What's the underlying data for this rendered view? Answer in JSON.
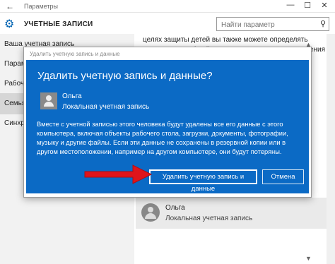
{
  "window": {
    "title": "Параметры",
    "back_glyph": "←",
    "minimize_glyph": "—",
    "maximize_glyph": "☐",
    "close_glyph": "✕"
  },
  "header": {
    "icon": "gear-icon",
    "title": "УЧЕТНЫЕ ЗАПИСИ",
    "search_placeholder": "Найти параметр",
    "search_icon": "search-icon"
  },
  "sidebar": {
    "items": [
      {
        "label": "Ваша учетная запись"
      },
      {
        "label": "Парамет"
      },
      {
        "label": "Рабочий"
      },
      {
        "label": "Семья"
      },
      {
        "label": "Синхрон"
      }
    ]
  },
  "main": {
    "paragraph": "целях защиты детей вы также можете определять допустимые веб-сайты, периоды времени, приложения и"
  },
  "user_card": {
    "name": "Ольга",
    "type": "Локальная учетная запись"
  },
  "dialog": {
    "frame_title": "Удалить учетную запись и данные",
    "title": "Удалить учетную запись и данные?",
    "user_name": "Ольга",
    "user_type": "Локальная учетная запись",
    "body": "Вместе с учетной записью этого человека будут удалены все его данные с этого компьютера, включая объекты рабочего стола, загрузки, документы, фотографии, музыку и другие файлы. Если эти данные не сохранены в резервной копии или в другом местоположении, например на другом компьютере, они будут потеряны.",
    "delete_label": "Удалить учетную запись и данные",
    "cancel_label": "Отмена"
  },
  "colors": {
    "dialog_blue": "#0b6ac5",
    "accent": "#0063b1",
    "arrow_red": "#e0141b"
  }
}
